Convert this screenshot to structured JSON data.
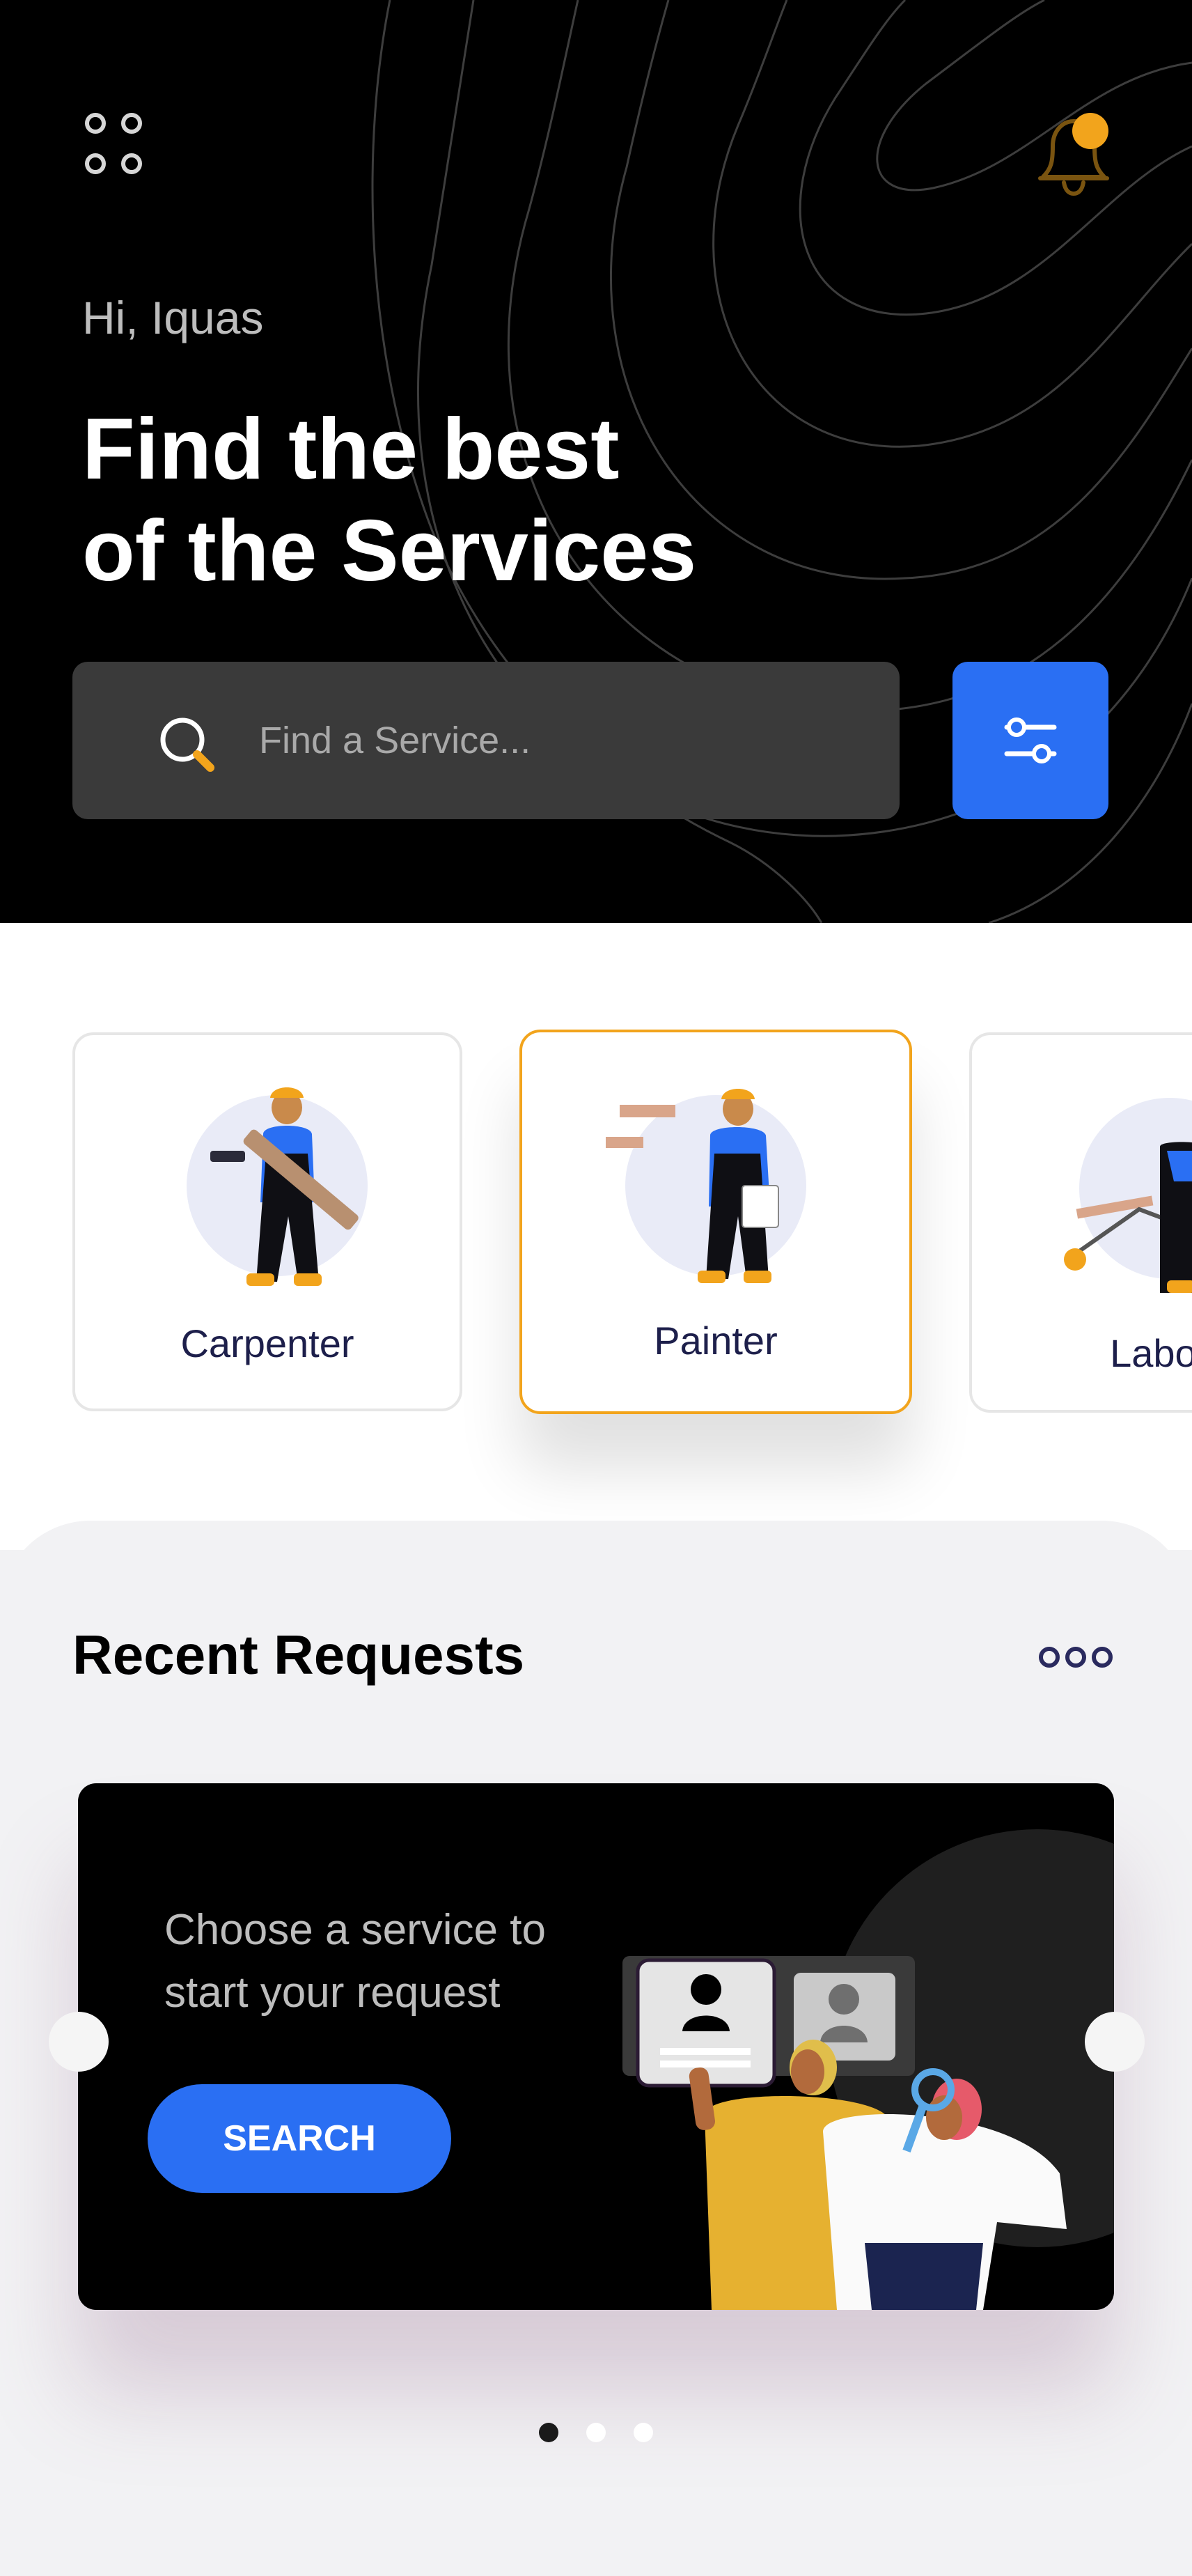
{
  "header": {
    "greeting": "Hi, Iquas",
    "headline_line1": "Find the best",
    "headline_line2": "of the Services",
    "menu_icon": "grid-dots-icon",
    "notification_icon": "bell-icon",
    "notification_badge_color": "#F2A41C"
  },
  "search": {
    "placeholder": "Find a Service...",
    "value": "",
    "search_icon": "search-icon",
    "filter_icon": "sliders-icon"
  },
  "categories": [
    {
      "label": "Carpenter",
      "selected": false
    },
    {
      "label": "Painter",
      "selected": true
    },
    {
      "label": "Labou",
      "selected": false
    }
  ],
  "recent_requests": {
    "title": "Recent Requests",
    "more_icon": "more-dots-icon",
    "promo_text": "Choose a service to start your request",
    "promo_button": "SEARCH",
    "carousel_pages": 3,
    "active_page": 1
  },
  "colors": {
    "accent_blue": "#2A6FF3",
    "accent_orange": "#F2A41C",
    "dark": "#000000",
    "navy_text": "#1D1F4B"
  }
}
